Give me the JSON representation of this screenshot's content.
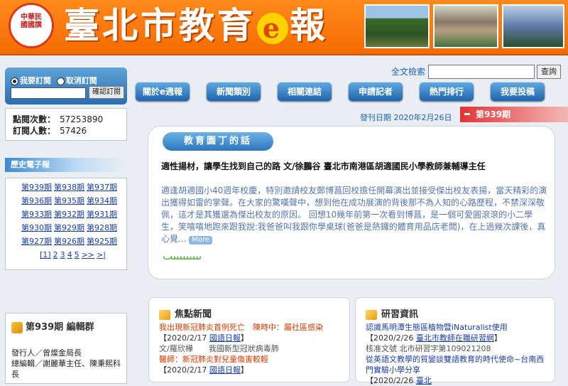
{
  "header": {
    "logo_lines": [
      "中華民",
      "國國旗"
    ],
    "title_pre": "臺北市教育",
    "title_e": "e",
    "title_post": "報"
  },
  "subscribe": {
    "option_subscribe": "我要訂閱",
    "option_cancel": "取消訂閱",
    "confirm_button": "確認訂閱"
  },
  "stats": {
    "views_label": "點閱次數：",
    "views_value": "57253890",
    "subs_label": "訂閱人數：",
    "subs_value": "57426"
  },
  "history": {
    "title": "歷史電子報",
    "issues": [
      "第939期",
      "第938期",
      "第937期",
      "第936期",
      "第935期",
      "第934期",
      "第933期",
      "第932期",
      "第931期",
      "第930期",
      "第929期",
      "第928期",
      "第927期",
      "第926期",
      "第925期"
    ],
    "pager": [
      "[1]",
      "2",
      "3",
      "4",
      "5",
      ">>",
      ">|"
    ]
  },
  "editor": {
    "title": "第939期 編輯群",
    "lines": [
      "發行人／曾燦金局長",
      "總編輯／謝麗華主任、陳秉熙科",
      "長"
    ]
  },
  "search": {
    "label": "全文檢索",
    "button": "查詢"
  },
  "nav": [
    "關於e週報",
    "新聞類別",
    "相關連結",
    "申請記者",
    "熱門排行",
    "我要投稿"
  ],
  "issue_info": {
    "date": "發刊日期 2020年2月26日",
    "issue": "第939期"
  },
  "feature": {
    "tag": "教育園丁的話",
    "title": "適性揚材，讓學生找到自己的路 文/徐鵬谷 臺北市南港區胡適國民小學教師兼輔導主任",
    "body": "適逢胡適國小40週年校慶，特別邀請校友鄭博菖回校擔任開幕演出並接受傑出校友表揚，當天精彩的演出獲得如雷的掌聲。在大家的驚嘆聲中，想到他在成功展演的背後那不為人知的心路歷程，不禁深深敬佩，這才是其獲選為傑出校友的原因。 回想10幾年前第一次看到博菖，是一個可愛圓滾滾的小二學生，笑嘻嘻地跑來跟我說:我爸爸叫我跟你學桌球(爸爸是熱鑼的體育用品店老闆)，在上過幾次課後，真心覺...",
    "more": "More"
  },
  "news": {
    "title": "焦點新聞",
    "items": [
      {
        "headline": "我出現新冠肺炎首例死亡　陳時中：屬社區感染",
        "meta_pre": "【2020/2/17 ",
        "meta_link": "國語日報",
        "meta_post": "】",
        "sub": "文/羅欣樺　　我國新型冠狀病毒肺"
      },
      {
        "headline": "醫師：新冠肺炎對兒童傷害較輕",
        "meta_pre": "【2020/2/17 ",
        "meta_link": "國語日報",
        "meta_post": "】"
      }
    ]
  },
  "learn": {
    "title": "研習資訊",
    "items": [
      {
        "headline": "認識馬明潭生態區植物暨iNaturalist使用",
        "meta_pre": "【2020/2/26 ",
        "meta_link": "臺北市教師在職研習網",
        "meta_post": "】",
        "sub": "核准文號 北市研習字第109021208"
      },
      {
        "headline": "從英語文教學的質變談雙語教育的時代使命~台南西門實驗小學分享",
        "meta_pre": "【2020/2/26 ",
        "meta_link": "臺北",
        "meta_post": ""
      }
    ]
  }
}
